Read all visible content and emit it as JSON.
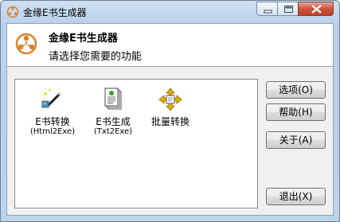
{
  "window": {
    "title": "金缘E书生成器",
    "controls": {
      "minimize": "minimize-icon",
      "maximize": "maximize-icon",
      "close": "close-icon"
    }
  },
  "header": {
    "title": "金缘E书生成器",
    "subtitle": "请选择您需要的功能",
    "logo_icon": "people-circle-logo-icon"
  },
  "tools": [
    {
      "label": "E书转换",
      "sub": "(Html2Exe)",
      "icon": "magic-wand-icon"
    },
    {
      "label": "E书生成",
      "sub": "(Txt2Exe)",
      "icon": "document-stack-icon"
    },
    {
      "label": "批量转换",
      "sub": "",
      "icon": "batch-arrows-icon"
    }
  ],
  "buttons": {
    "options": "选项(O)",
    "help": "帮助(H)",
    "about": "关于(A)",
    "exit": "退出(X)"
  },
  "colors": {
    "title_bar": "#b9d1ea",
    "close_button": "#c8543e",
    "client_bg": "#f0f0f0"
  }
}
